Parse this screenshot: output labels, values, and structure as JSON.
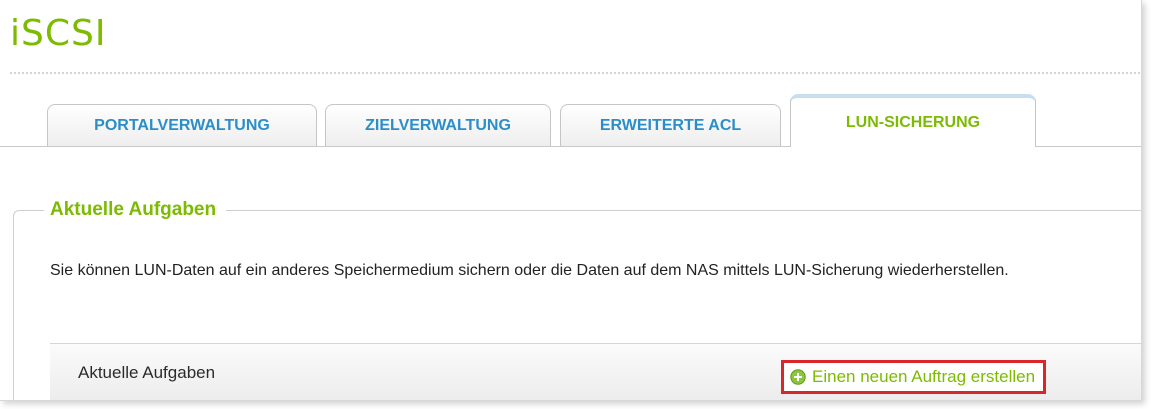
{
  "page": {
    "title": "iSCSI"
  },
  "tabs": [
    {
      "label": "PORTALVERWALTUNG",
      "active": false
    },
    {
      "label": "ZIELVERWALTUNG",
      "active": false
    },
    {
      "label": "ERWEITERTE ACL",
      "active": false
    },
    {
      "label": "LUN-SICHERUNG",
      "active": true
    }
  ],
  "section": {
    "legend": "Aktuelle Aufgaben",
    "description": "Sie können LUN-Daten auf ein anderes Speichermedium sichern oder die Daten auf dem NAS mittels LUN-Sicherung wiederherstellen.",
    "task_bar": {
      "title": "Aktuelle Aufgaben",
      "new_job_button": {
        "label": "Einen neuen Auftrag erstellen",
        "icon": "plus-circle-icon"
      }
    }
  },
  "colors": {
    "accent_green": "#7cbb00",
    "tab_blue": "#2c8ec9",
    "highlight_red": "#d9262b"
  }
}
